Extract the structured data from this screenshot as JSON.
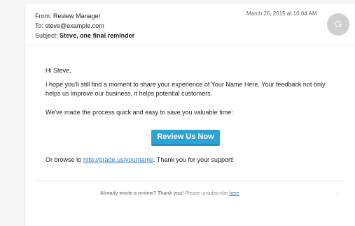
{
  "email": {
    "from_label": "From:",
    "from_value": "Review Manager",
    "to_label": "To:",
    "to_value": "steve@example.com",
    "subject_label": "Subject:",
    "subject_value": "Steve, one final reminder",
    "date": "March 26, 2015 at 10:04 AM",
    "avatar_initial": "G"
  },
  "body": {
    "greeting": "Hi Steve,",
    "paragraph1": "I hope you'll still find a moment to share your experience of Your Name Here. Your feedback not only helps us improve our business, it helps potential customers.",
    "paragraph2": "We've made the process quick and easy to save you valuable time:",
    "cta_label": "Review Us Now",
    "browse_prefix": "Or browse to ",
    "browse_link": "http://grade.us/yourname",
    "browse_suffix": ". Thank you for your support!"
  },
  "footer": {
    "bold_text": "Already wrote a review? Thank you!",
    "text": " Please unsubscribe ",
    "link": "here",
    "end": "."
  },
  "icons": {
    "arrow": "arrow-right-icon"
  }
}
